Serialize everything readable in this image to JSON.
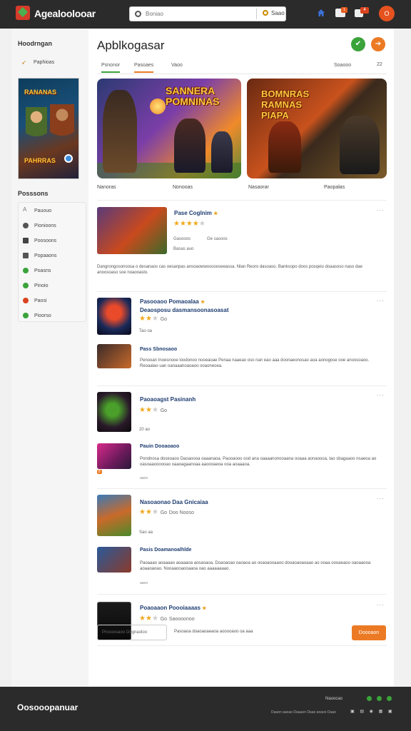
{
  "header": {
    "app_name": "Agealoolooar",
    "search_placeholder": "Boniao",
    "search_button": "Saao",
    "badge_a": "1",
    "badge_b": "4",
    "avatar_initial": "O"
  },
  "sidebar": {
    "title": "Hoodrngan",
    "link_label": "Paphioas",
    "banner_line1": "RANANAS",
    "banner_line2": "PAHRRAS",
    "section_title": "Posssons",
    "categories": [
      {
        "label": "Pauouo",
        "color": "#777777"
      },
      {
        "label": "Pionioons",
        "color": "#555555"
      },
      {
        "label": "Poosoons",
        "color": "#444444"
      },
      {
        "label": "Popaaons",
        "color": "#555555"
      },
      {
        "label": "Poasns",
        "color": "#3aa33a"
      },
      {
        "label": "Pinoio",
        "color": "#3aa33a"
      },
      {
        "label": "Paosi",
        "color": "#d9431f"
      },
      {
        "label": "Pioorso",
        "color": "#3aa33a"
      }
    ]
  },
  "main": {
    "title": "Apblkogasar",
    "green_btn": "✔",
    "orange_btn": "➔",
    "tabs": [
      "Psnonor",
      "Pasoaes",
      "Vaoo"
    ],
    "sort_label": "Soaooo",
    "grid_label": "22",
    "featured": [
      {
        "title": "SANNERA\nPOMNINAS"
      },
      {
        "title": "BOMNRAS\nRAMNAS\nPIAPA"
      }
    ],
    "featured_labels": [
      "Nanoras",
      "Nonooas",
      "Nasaorar",
      "Paopalas"
    ]
  },
  "items": [
    {
      "title": "Pase Coglnim",
      "rating": 4,
      "rating_num": "Gasooos",
      "meta2": "Ge sasoos",
      "meta": "Basas auo",
      "desc": "Dangrongosonoosa o desanaos cas oesanpas ansoaowwosoooseeassa. Nlan Reoro dasoaso. Banksopo doos posqeiu doaasoso naso dae anoosoaso soe noaooaslo."
    },
    {
      "title": "Pasooaoo Pomaoalaa",
      "title2": "Deaosposu dasmansoonasoasat",
      "rating": 2,
      "rating_num": "Go",
      "meta": "Tao oa",
      "sub_title": "Pass Sbnosaoo",
      "sub_desc": "Penooan Inoesnooe loodonoo nooeaoae Penaa naaeao oso nan eao aaa doonaeonosao aoa aonogose ooe anoosoaoo. Reoaalao uan oanaaanoaoaoo ooaoneoea."
    },
    {
      "title": "Paoaoagst Pasinanh",
      "rating": 2,
      "rating_num": "Go",
      "meta": "20 ao",
      "sub_title": "Pauin Dooaoaoo",
      "sub_desc": "Pondnosa doseoaoo Daoaoooa oaaanaoa. Paooaooo ood ana oaaaanonooaana ooaaa aonaoooa, tao sbagaaoo nsaeoa ao oasoaaoooooao oaaoagaanoaa aaoooaeoa ooa aoaaaoa.",
      "tag": "8",
      "tiny": "aaoo"
    },
    {
      "title": "Nasoaonao Daa Gnicaiaa",
      "rating": 2,
      "rating_num": "Go",
      "meta2": "Doo Nooso",
      "meta": "Sao aa",
      "sub_title": "Pasis Doamanoalhlde",
      "sub_desc": "Paoaaao aoaaaao aoaaaoa aosaoaoa. Doaoaoao oaoaoa ao ooaoaooaaoo dooaoaoaoaao ao ooaa oooaeaoo oaoaaooa aoaaoaoao. Nooaaooaooaaoa oao aaaaaaaao.",
      "tiny": "aaoo"
    },
    {
      "title": "Poaoaaon Poooiaaaas",
      "rating": 2,
      "rating_num": "Go",
      "meta2": "Saoooonoo"
    }
  ],
  "load_more": {
    "input": "Prosoosaoo Oognaoloo",
    "text": "Pasoaoa doaoaoaeaoa aooooaoo oa aaa",
    "button": "Doooaon"
  },
  "footer": {
    "brand": "Oosooopanuar",
    "right_label": "Naoocao",
    "links": "Daaon aaoao  Daaaon  Daao aoaoo  Daao"
  }
}
